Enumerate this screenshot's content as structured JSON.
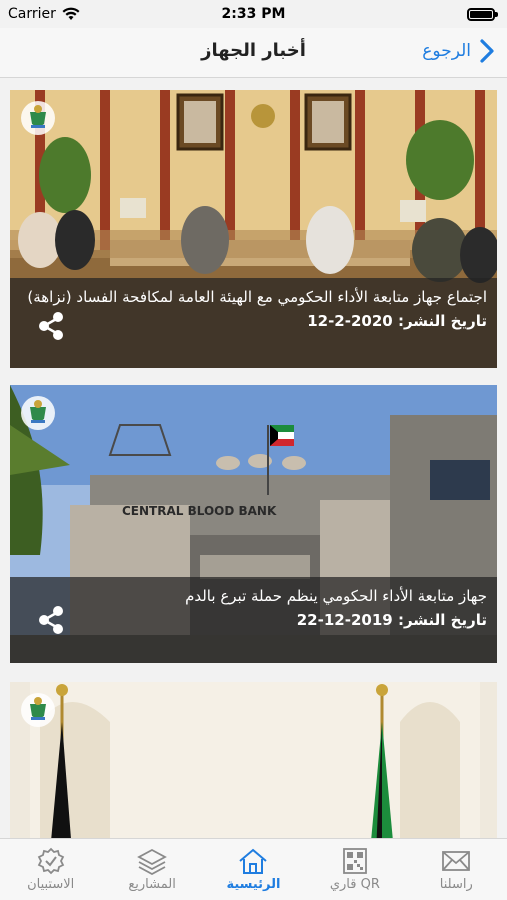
{
  "status": {
    "carrier": "Carrier",
    "time": "2:33 PM"
  },
  "nav": {
    "title": "أخبار الجهاز",
    "back_label": "الرجوع"
  },
  "news": [
    {
      "title": "اجتماع جهاز متابعة الأداء الحكومي مع الهيئة العامة لمكافحة الفساد (نزاهة)",
      "date": "تاريخ النشر: 2020-2-12"
    },
    {
      "title": "جهاز متابعة الأداء الحكومي ينظم حملة تبرع بالدم",
      "date": "تاريخ النشر: 2019-12-22"
    },
    {
      "title": "",
      "date": ""
    }
  ],
  "photo_text": {
    "blood_bank_en": "CENTRAL BLOOD BANK"
  },
  "tabs": [
    {
      "label": "الاستبيان",
      "icon": "badge-check-icon"
    },
    {
      "label": "المشاريع",
      "icon": "layers-icon"
    },
    {
      "label": "الرئيسية",
      "icon": "home-icon",
      "active": true
    },
    {
      "label": "قاري QR",
      "icon": "qr-icon"
    },
    {
      "label": "راسلنا",
      "icon": "mail-icon"
    }
  ],
  "colors": {
    "accent": "#1f7de0",
    "overlay": "#232323",
    "inactive": "#8a8a8a"
  }
}
